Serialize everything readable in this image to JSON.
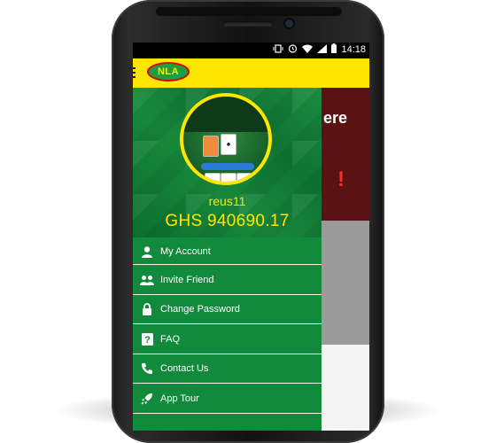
{
  "status_bar": {
    "time": "14:18",
    "icons": [
      "vibrate-icon",
      "alarm-icon",
      "wifi-icon",
      "signal-icon",
      "battery-icon"
    ]
  },
  "app_bar": {
    "logo_text": "NLA",
    "menu_icon": "hamburger-icon"
  },
  "background_screen": {
    "heading_fragment": "ere",
    "promo_fragment": "!"
  },
  "drawer": {
    "username": "reus11",
    "balance": "GHS 940690.17",
    "items": [
      {
        "label": "My Account",
        "icon": "user-icon"
      },
      {
        "label": "Invite Friend",
        "icon": "users-icon"
      },
      {
        "label": "Change Password",
        "icon": "lock-icon"
      },
      {
        "label": "FAQ",
        "icon": "question-icon"
      },
      {
        "label": "Contact Us",
        "icon": "phone-icon"
      },
      {
        "label": "App Tour",
        "icon": "rocket-icon"
      }
    ]
  },
  "colors": {
    "drawer_green": "#128a3c",
    "accent_yellow": "#ffe600",
    "app_bar_yellow": "#ffe600",
    "status_bar": "#000000"
  }
}
